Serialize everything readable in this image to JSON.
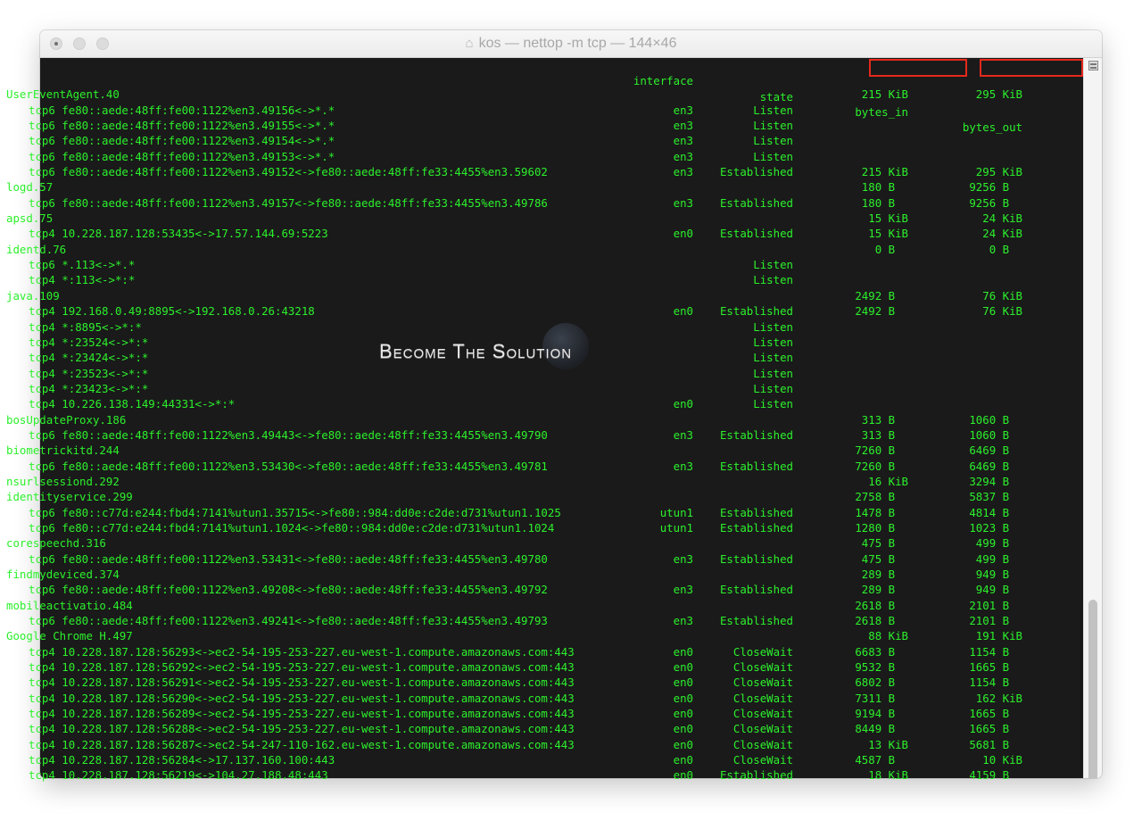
{
  "window": {
    "title": "kos — nettop -m tcp — 144×46",
    "title_icon": "home-icon"
  },
  "header": {
    "interface": "interface",
    "state": "state",
    "bytes_in": "bytes_in",
    "bytes_out": "bytes_out",
    "highlighted_columns": [
      "bytes_in",
      "bytes_out"
    ],
    "highlight_color": "#e5291c"
  },
  "colors": {
    "terminal_bg": "#1a1a1a",
    "text": "#2cf02c"
  },
  "watermark": "Become The Solution",
  "rows": [
    {
      "type": "process",
      "name": "UserEventAgent.40",
      "bytes_in": "215 KiB",
      "bytes_out": "295 KiB"
    },
    {
      "type": "conn",
      "conn": "tcp6 fe80::aede:48ff:fe00:1122%en3.49156<->*.*",
      "interface": "en3",
      "state": "Listen",
      "bytes_in": "",
      "bytes_out": ""
    },
    {
      "type": "conn",
      "conn": "tcp6 fe80::aede:48ff:fe00:1122%en3.49155<->*.*",
      "interface": "en3",
      "state": "Listen",
      "bytes_in": "",
      "bytes_out": ""
    },
    {
      "type": "conn",
      "conn": "tcp6 fe80::aede:48ff:fe00:1122%en3.49154<->*.*",
      "interface": "en3",
      "state": "Listen",
      "bytes_in": "",
      "bytes_out": ""
    },
    {
      "type": "conn",
      "conn": "tcp6 fe80::aede:48ff:fe00:1122%en3.49153<->*.*",
      "interface": "en3",
      "state": "Listen",
      "bytes_in": "",
      "bytes_out": ""
    },
    {
      "type": "conn",
      "conn": "tcp6 fe80::aede:48ff:fe00:1122%en3.49152<->fe80::aede:48ff:fe33:4455%en3.59602",
      "interface": "en3",
      "state": "Established",
      "bytes_in": "215 KiB",
      "bytes_out": "295 KiB"
    },
    {
      "type": "process",
      "name": "logd.57",
      "bytes_in": "180 B",
      "bytes_out": "9256 B"
    },
    {
      "type": "conn",
      "conn": "tcp6 fe80::aede:48ff:fe00:1122%en3.49157<->fe80::aede:48ff:fe33:4455%en3.49786",
      "interface": "en3",
      "state": "Established",
      "bytes_in": "180 B",
      "bytes_out": "9256 B"
    },
    {
      "type": "process",
      "name": "apsd.75",
      "bytes_in": "15 KiB",
      "bytes_out": "24 KiB"
    },
    {
      "type": "conn",
      "conn": "tcp4 10.228.187.128:53435<->17.57.144.69:5223",
      "interface": "en0",
      "state": "Established",
      "bytes_in": "15 KiB",
      "bytes_out": "24 KiB"
    },
    {
      "type": "process",
      "name": "identd.76",
      "bytes_in": "0 B",
      "bytes_out": "0 B"
    },
    {
      "type": "conn",
      "conn": "tcp6 *.113<->*.*",
      "interface": "",
      "state": "Listen",
      "bytes_in": "",
      "bytes_out": ""
    },
    {
      "type": "conn",
      "conn": "tcp4 *:113<->*:*",
      "interface": "",
      "state": "Listen",
      "bytes_in": "",
      "bytes_out": ""
    },
    {
      "type": "process",
      "name": "java.109",
      "bytes_in": "2492 B",
      "bytes_out": "76 KiB"
    },
    {
      "type": "conn",
      "conn": "tcp4 192.168.0.49:8895<->192.168.0.26:43218",
      "interface": "en0",
      "state": "Established",
      "bytes_in": "2492 B",
      "bytes_out": "76 KiB"
    },
    {
      "type": "conn",
      "conn": "tcp4 *:8895<->*:*",
      "interface": "",
      "state": "Listen",
      "bytes_in": "",
      "bytes_out": ""
    },
    {
      "type": "conn",
      "conn": "tcp4 *:23524<->*:*",
      "interface": "",
      "state": "Listen",
      "bytes_in": "",
      "bytes_out": ""
    },
    {
      "type": "conn",
      "conn": "tcp4 *:23424<->*:*",
      "interface": "",
      "state": "Listen",
      "bytes_in": "",
      "bytes_out": ""
    },
    {
      "type": "conn",
      "conn": "tcp4 *:23523<->*:*",
      "interface": "",
      "state": "Listen",
      "bytes_in": "",
      "bytes_out": ""
    },
    {
      "type": "conn",
      "conn": "tcp4 *:23423<->*:*",
      "interface": "",
      "state": "Listen",
      "bytes_in": "",
      "bytes_out": ""
    },
    {
      "type": "conn",
      "conn": "tcp4 10.226.138.149:44331<->*:*",
      "interface": "en0",
      "state": "Listen",
      "bytes_in": "",
      "bytes_out": ""
    },
    {
      "type": "process",
      "name": "bosUpdateProxy.186",
      "bytes_in": "313 B",
      "bytes_out": "1060 B"
    },
    {
      "type": "conn",
      "conn": "tcp6 fe80::aede:48ff:fe00:1122%en3.49443<->fe80::aede:48ff:fe33:4455%en3.49790",
      "interface": "en3",
      "state": "Established",
      "bytes_in": "313 B",
      "bytes_out": "1060 B"
    },
    {
      "type": "process",
      "name": "biometrickitd.244",
      "bytes_in": "7260 B",
      "bytes_out": "6469 B"
    },
    {
      "type": "conn",
      "conn": "tcp6 fe80::aede:48ff:fe00:1122%en3.53430<->fe80::aede:48ff:fe33:4455%en3.49781",
      "interface": "en3",
      "state": "Established",
      "bytes_in": "7260 B",
      "bytes_out": "6469 B"
    },
    {
      "type": "process",
      "name": "nsurlsessiond.292",
      "bytes_in": "16 KiB",
      "bytes_out": "3294 B"
    },
    {
      "type": "process",
      "name": "identityservice.299",
      "bytes_in": "2758 B",
      "bytes_out": "5837 B"
    },
    {
      "type": "conn",
      "conn": "tcp6 fe80::c77d:e244:fbd4:7141%utun1.35715<->fe80::984:dd0e:c2de:d731%utun1.1025",
      "interface": "utun1",
      "state": "Established",
      "bytes_in": "1478 B",
      "bytes_out": "4814 B"
    },
    {
      "type": "conn",
      "conn": "tcp6 fe80::c77d:e244:fbd4:7141%utun1.1024<->fe80::984:dd0e:c2de:d731%utun1.1024",
      "interface": "utun1",
      "state": "Established",
      "bytes_in": "1280 B",
      "bytes_out": "1023 B"
    },
    {
      "type": "process",
      "name": "corespeechd.316",
      "bytes_in": "475 B",
      "bytes_out": "499 B"
    },
    {
      "type": "conn",
      "conn": "tcp6 fe80::aede:48ff:fe00:1122%en3.53431<->fe80::aede:48ff:fe33:4455%en3.49780",
      "interface": "en3",
      "state": "Established",
      "bytes_in": "475 B",
      "bytes_out": "499 B"
    },
    {
      "type": "process",
      "name": "findmydeviced.374",
      "bytes_in": "289 B",
      "bytes_out": "949 B"
    },
    {
      "type": "conn",
      "conn": "tcp6 fe80::aede:48ff:fe00:1122%en3.49208<->fe80::aede:48ff:fe33:4455%en3.49792",
      "interface": "en3",
      "state": "Established",
      "bytes_in": "289 B",
      "bytes_out": "949 B"
    },
    {
      "type": "process",
      "name": "mobileactivatio.484",
      "bytes_in": "2618 B",
      "bytes_out": "2101 B"
    },
    {
      "type": "conn",
      "conn": "tcp6 fe80::aede:48ff:fe00:1122%en3.49241<->fe80::aede:48ff:fe33:4455%en3.49793",
      "interface": "en3",
      "state": "Established",
      "bytes_in": "2618 B",
      "bytes_out": "2101 B"
    },
    {
      "type": "process",
      "name": "Google Chrome H.497",
      "bytes_in": "88 KiB",
      "bytes_out": "191 KiB"
    },
    {
      "type": "conn",
      "conn": "tcp4 10.228.187.128:56293<->ec2-54-195-253-227.eu-west-1.compute.amazonaws.com:443",
      "interface": "en0",
      "state": "CloseWait",
      "bytes_in": "6683 B",
      "bytes_out": "1154 B"
    },
    {
      "type": "conn",
      "conn": "tcp4 10.228.187.128:56292<->ec2-54-195-253-227.eu-west-1.compute.amazonaws.com:443",
      "interface": "en0",
      "state": "CloseWait",
      "bytes_in": "9532 B",
      "bytes_out": "1665 B"
    },
    {
      "type": "conn",
      "conn": "tcp4 10.228.187.128:56291<->ec2-54-195-253-227.eu-west-1.compute.amazonaws.com:443",
      "interface": "en0",
      "state": "CloseWait",
      "bytes_in": "6802 B",
      "bytes_out": "1154 B"
    },
    {
      "type": "conn",
      "conn": "tcp4 10.228.187.128:56290<->ec2-54-195-253-227.eu-west-1.compute.amazonaws.com:443",
      "interface": "en0",
      "state": "CloseWait",
      "bytes_in": "7311 B",
      "bytes_out": "162 KiB"
    },
    {
      "type": "conn",
      "conn": "tcp4 10.228.187.128:56289<->ec2-54-195-253-227.eu-west-1.compute.amazonaws.com:443",
      "interface": "en0",
      "state": "CloseWait",
      "bytes_in": "9194 B",
      "bytes_out": "1665 B"
    },
    {
      "type": "conn",
      "conn": "tcp4 10.228.187.128:56288<->ec2-54-195-253-227.eu-west-1.compute.amazonaws.com:443",
      "interface": "en0",
      "state": "CloseWait",
      "bytes_in": "8449 B",
      "bytes_out": "1665 B"
    },
    {
      "type": "conn",
      "conn": "tcp4 10.228.187.128:56287<->ec2-54-247-110-162.eu-west-1.compute.amazonaws.com:443",
      "interface": "en0",
      "state": "CloseWait",
      "bytes_in": "13 KiB",
      "bytes_out": "5681 B"
    },
    {
      "type": "conn",
      "conn": "tcp4 10.228.187.128:56284<->17.137.160.100:443",
      "interface": "en0",
      "state": "CloseWait",
      "bytes_in": "4587 B",
      "bytes_out": "10 KiB"
    },
    {
      "type": "conn",
      "conn": "tcp4 10.228.187.128:56219<->104.27.188.48:443",
      "interface": "en0",
      "state": "Established",
      "bytes_in": "18 KiB",
      "bytes_out": "4159 B"
    }
  ]
}
